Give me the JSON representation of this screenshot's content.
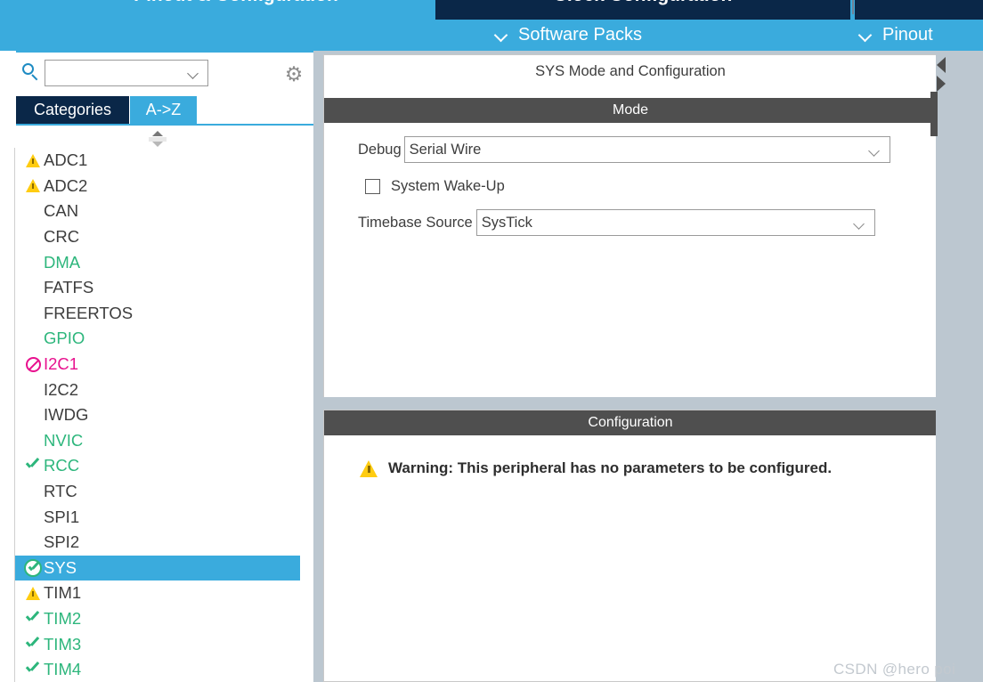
{
  "header": {
    "tabs": [
      {
        "label": "Pinout & Configuration",
        "state": "active"
      },
      {
        "label": "Clock Configuration",
        "state": "inactive"
      },
      {
        "label": "",
        "state": "inactive"
      }
    ],
    "actions": [
      {
        "label": "Software Packs",
        "icon": "chevron-down-icon"
      },
      {
        "label": "Pinout",
        "icon": "chevron-down-icon"
      }
    ],
    "colors": {
      "accent_light": "#3aabdd",
      "accent_dark": "#0a2748"
    }
  },
  "sidebar": {
    "search": {
      "icon": "search-icon",
      "value": "",
      "placeholder": ""
    },
    "settings_icon": "gear-icon",
    "tabs": [
      {
        "label": "Categories",
        "selected": true
      },
      {
        "label": "A->Z",
        "selected": false
      }
    ],
    "spinner_icon": "scroll-spinner-icon",
    "items": [
      {
        "label": "ADC1",
        "icon": "warning-icon",
        "state": "warning",
        "selected": false
      },
      {
        "label": "ADC2",
        "icon": "warning-icon",
        "state": "warning",
        "selected": false
      },
      {
        "label": "CAN",
        "icon": "none",
        "state": "default",
        "selected": false
      },
      {
        "label": "CRC",
        "icon": "none",
        "state": "default",
        "selected": false
      },
      {
        "label": "DMA",
        "icon": "none",
        "state": "enabled",
        "selected": false
      },
      {
        "label": "FATFS",
        "icon": "none",
        "state": "default",
        "selected": false
      },
      {
        "label": "FREERTOS",
        "icon": "none",
        "state": "default",
        "selected": false
      },
      {
        "label": "GPIO",
        "icon": "none",
        "state": "enabled",
        "selected": false
      },
      {
        "label": "I2C1",
        "icon": "forbidden-icon",
        "state": "conflict",
        "selected": false
      },
      {
        "label": "I2C2",
        "icon": "none",
        "state": "default",
        "selected": false
      },
      {
        "label": "IWDG",
        "icon": "none",
        "state": "default",
        "selected": false
      },
      {
        "label": "NVIC",
        "icon": "none",
        "state": "enabled",
        "selected": false
      },
      {
        "label": "RCC",
        "icon": "check-icon",
        "state": "enabled",
        "selected": false
      },
      {
        "label": "RTC",
        "icon": "none",
        "state": "default",
        "selected": false
      },
      {
        "label": "SPI1",
        "icon": "none",
        "state": "default",
        "selected": false
      },
      {
        "label": "SPI2",
        "icon": "none",
        "state": "default",
        "selected": false
      },
      {
        "label": "SYS",
        "icon": "circle-check-icon",
        "state": "enabled",
        "selected": true
      },
      {
        "label": "TIM1",
        "icon": "warning-icon",
        "state": "warning",
        "selected": false
      },
      {
        "label": "TIM2",
        "icon": "check-icon",
        "state": "enabled",
        "selected": false
      },
      {
        "label": "TIM3",
        "icon": "check-icon",
        "state": "enabled",
        "selected": false
      },
      {
        "label": "TIM4",
        "icon": "check-icon",
        "state": "enabled",
        "selected": false
      }
    ],
    "colors": {
      "enabled_text": "#2db67c",
      "conflict_text": "#e8118e",
      "default_text": "#3d3d3d",
      "selection": "#3aabdd",
      "scrollbar": "#3aabdd"
    }
  },
  "main": {
    "title": "SYS Mode and Configuration",
    "mode_section": {
      "header": "Mode",
      "debug": {
        "label": "Debug",
        "value": "Serial Wire"
      },
      "system_wakeup": {
        "label": "System Wake-Up",
        "checked": false
      },
      "timebase": {
        "label": "Timebase Source",
        "value": "SysTick"
      }
    },
    "configuration_section": {
      "header": "Configuration",
      "warning_icon": "warning-icon",
      "warning_text": "Warning: This peripheral has no parameters to be configured."
    },
    "collapse_controls": {
      "up_icon": "collapse-left-icon",
      "down_icon": "collapse-right-icon"
    }
  },
  "watermark": {
    "text": "CSDN @hero poi"
  }
}
